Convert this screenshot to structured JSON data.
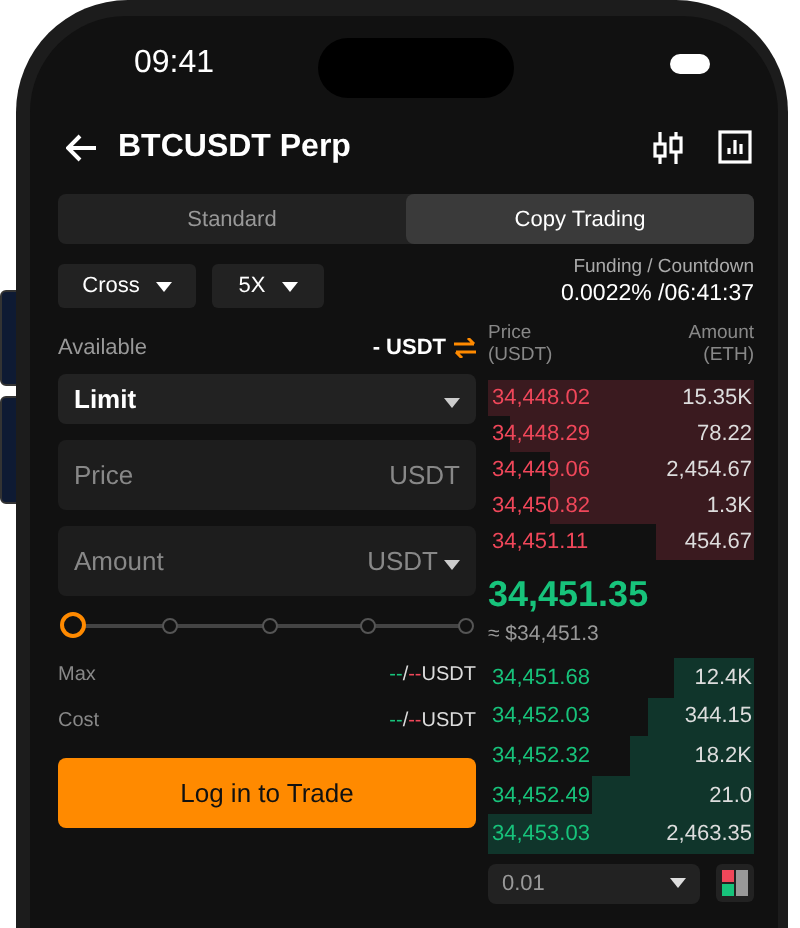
{
  "status_bar": {
    "time": "09:41"
  },
  "header": {
    "title": "BTCUSDT Perp"
  },
  "mode_tabs": [
    {
      "label": "Standard",
      "selected": false
    },
    {
      "label": "Copy Trading",
      "selected": true
    }
  ],
  "margin_mode": "Cross",
  "leverage": "5X",
  "funding": {
    "label": "Funding / Countdown",
    "value": "0.0022% /06:41:37"
  },
  "available": {
    "label": "Available",
    "value": "- USDT"
  },
  "order_type": "Limit",
  "price_field": {
    "placeholder": "Price",
    "unit": "USDT"
  },
  "amount_field": {
    "placeholder": "Amount",
    "unit": "USDT"
  },
  "slider": {
    "level": 0
  },
  "summary": [
    {
      "label": "Max",
      "buy": "--",
      "separator": "/",
      "sell": "--",
      "unit": "USDT"
    },
    {
      "label": "Cost",
      "buy": "--",
      "separator": "/",
      "sell": "--",
      "unit": "USDT"
    }
  ],
  "trade_button": "Log in to Trade",
  "order_book": {
    "price_header": "Price (USDT)",
    "amount_header": "Amount (ETH)",
    "asks": [
      {
        "price": "34,448.02",
        "amount": "15.35K"
      },
      {
        "price": "34,448.29",
        "amount": "78.22"
      },
      {
        "price": "34,449.06",
        "amount": "2,454.67"
      },
      {
        "price": "34,450.82",
        "amount": "1.3K"
      },
      {
        "price": "34,451.11",
        "amount": "454.67"
      }
    ],
    "last_price": "34,451.35",
    "last_price_usd": "≈ $34,451.3",
    "bids": [
      {
        "price": "34,451.68",
        "amount": "12.4K"
      },
      {
        "price": "34,452.03",
        "amount": "344.15"
      },
      {
        "price": "34,452.32",
        "amount": "18.2K"
      },
      {
        "price": "34,452.49",
        "amount": "21.0"
      },
      {
        "price": "34,453.03",
        "amount": "2,463.35"
      }
    ],
    "precision": "0.01"
  }
}
